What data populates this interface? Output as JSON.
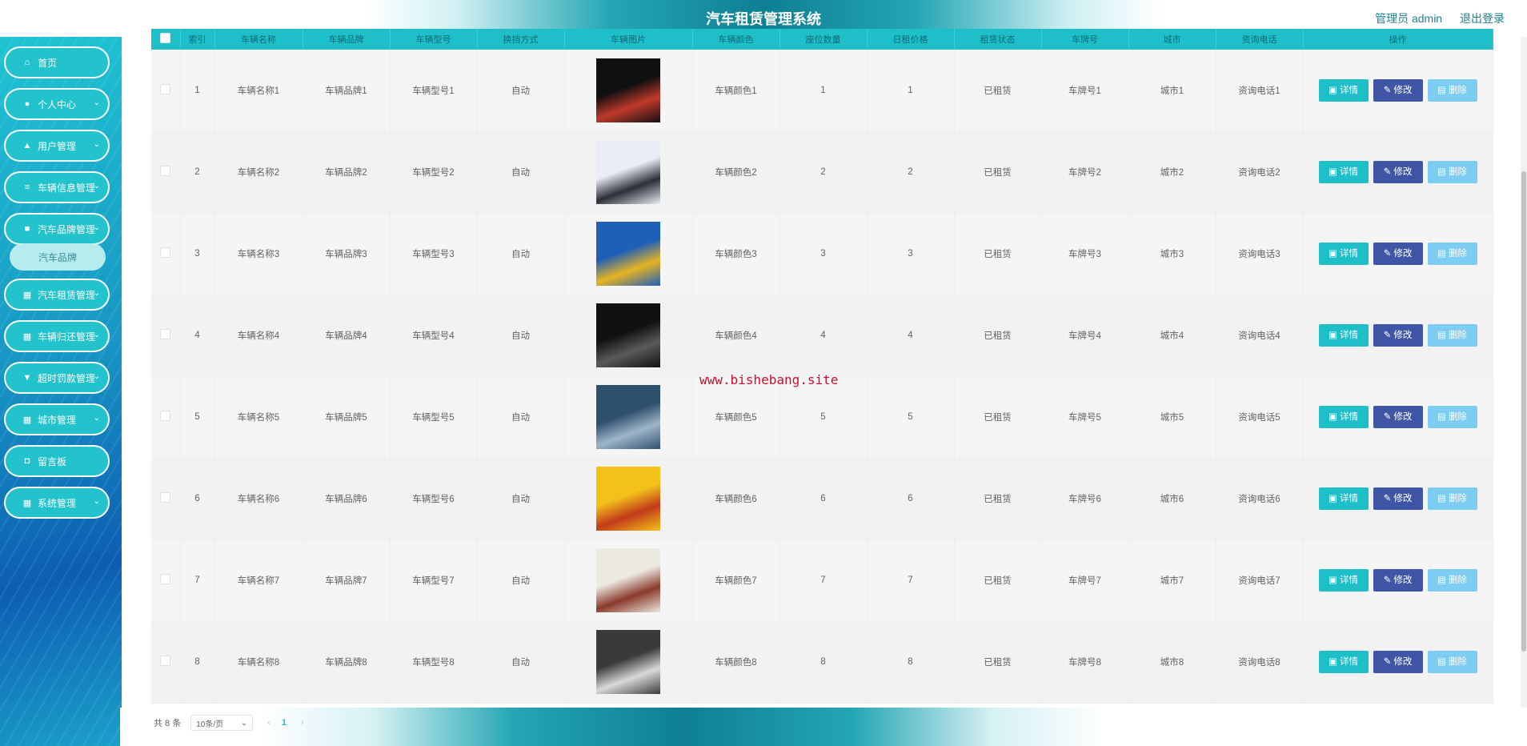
{
  "header": {
    "title": "汽车租赁管理系统",
    "user_label": "管理员 admin",
    "logout": "退出登录"
  },
  "sidebar": {
    "items": [
      {
        "label": "首页",
        "icon": "home-icon",
        "glyph": "⌂",
        "has_children": false
      },
      {
        "label": "个人中心",
        "icon": "user-icon",
        "glyph": "●",
        "has_children": true
      },
      {
        "label": "用户管理",
        "icon": "thumb-icon",
        "glyph": "▲",
        "has_children": true
      },
      {
        "label": "车辆信息管理",
        "icon": "menu-icon",
        "glyph": "≡",
        "has_children": true
      },
      {
        "label": "汽车品牌管理",
        "icon": "clipboard-icon",
        "glyph": "■",
        "has_children": true
      },
      {
        "label": "汽车租赁管理",
        "icon": "grid-icon",
        "glyph": "▦",
        "has_children": true
      },
      {
        "label": "车辆归还管理",
        "icon": "grid-icon",
        "glyph": "▦",
        "has_children": true
      },
      {
        "label": "超时罚款管理",
        "icon": "trophy-icon",
        "glyph": "▼",
        "has_children": true
      },
      {
        "label": "城市管理",
        "icon": "grid-icon",
        "glyph": "▦",
        "has_children": true
      },
      {
        "label": "留言板",
        "icon": "message-icon",
        "glyph": "◘",
        "has_children": false
      },
      {
        "label": "系统管理",
        "icon": "grid-icon",
        "glyph": "▦",
        "has_children": true
      }
    ],
    "open_submenu": {
      "label": "汽车品牌"
    }
  },
  "table": {
    "columns": [
      "",
      "索引",
      "车辆名称",
      "车辆品牌",
      "车辆型号",
      "换挡方式",
      "车辆图片",
      "车辆颜色",
      "座位数量",
      "日租价格",
      "租赁状态",
      "车牌号",
      "城市",
      "资询电话",
      "操作"
    ],
    "rows": [
      {
        "index": "1",
        "name": "车辆名称1",
        "brand": "车辆品牌1",
        "model": "车辆型号1",
        "shift": "自动",
        "color": "车辆颜色1",
        "seats": "1",
        "price": "1",
        "status": "已租赁",
        "plate": "车牌号1",
        "city": "城市1",
        "phone": "资询电话1",
        "img": [
          "#101010",
          "#c0392b"
        ]
      },
      {
        "index": "2",
        "name": "车辆名称2",
        "brand": "车辆品牌2",
        "model": "车辆型号2",
        "shift": "自动",
        "color": "车辆颜色2",
        "seats": "2",
        "price": "2",
        "status": "已租赁",
        "plate": "车牌号2",
        "city": "城市2",
        "phone": "资询电话2",
        "img": [
          "#e8eef3",
          "#2b2f36"
        ]
      },
      {
        "index": "3",
        "name": "车辆名称3",
        "brand": "车辆品牌3",
        "model": "车辆型号3",
        "shift": "自动",
        "color": "车辆颜色3",
        "seats": "3",
        "price": "3",
        "status": "已租赁",
        "plate": "车牌号3",
        "city": "城市3",
        "phone": "资询电话3",
        "img": [
          "#1e5fb8",
          "#e6b422"
        ]
      },
      {
        "index": "4",
        "name": "车辆名称4",
        "brand": "车辆品牌4",
        "model": "车辆型号4",
        "shift": "自动",
        "color": "车辆颜色4",
        "seats": "4",
        "price": "4",
        "status": "已租赁",
        "plate": "车牌号4",
        "city": "城市4",
        "phone": "资询电话4",
        "img": [
          "#111111",
          "#5a5a5a"
        ]
      },
      {
        "index": "5",
        "name": "车辆名称5",
        "brand": "车辆品牌5",
        "model": "车辆型号5",
        "shift": "自动",
        "color": "车辆颜色5",
        "seats": "5",
        "price": "5",
        "status": "已租赁",
        "plate": "车牌号5",
        "city": "城市5",
        "phone": "资询电话5",
        "img": [
          "#2f4f6f",
          "#9fb6c8"
        ]
      },
      {
        "index": "6",
        "name": "车辆名称6",
        "brand": "车辆品牌6",
        "model": "车辆型号6",
        "shift": "自动",
        "color": "车辆颜色6",
        "seats": "6",
        "price": "6",
        "status": "已租赁",
        "plate": "车牌号6",
        "city": "城市6",
        "phone": "资询电话6",
        "img": [
          "#f2c21b",
          "#c23a1a"
        ]
      },
      {
        "index": "7",
        "name": "车辆名称7",
        "brand": "车辆品牌7",
        "model": "车辆型号7",
        "shift": "自动",
        "color": "车辆颜色7",
        "seats": "7",
        "price": "7",
        "status": "已租赁",
        "plate": "车牌号7",
        "city": "城市7",
        "phone": "资询电话7",
        "img": [
          "#ece8e2",
          "#8a3a2a"
        ]
      },
      {
        "index": "8",
        "name": "车辆名称8",
        "brand": "车辆品牌8",
        "model": "车辆型号8",
        "shift": "自动",
        "color": "车辆颜色8",
        "seats": "8",
        "price": "8",
        "status": "已租赁",
        "plate": "车牌号8",
        "city": "城市8",
        "phone": "资询电话8",
        "img": [
          "#3a3a3a",
          "#d9d9d9"
        ]
      }
    ],
    "actions": {
      "detail": "详情",
      "edit": "修改",
      "delete": "删除"
    }
  },
  "watermark": "www.bishebang.site",
  "pagination": {
    "total": "共 8 条",
    "page_size": "10条/页",
    "current_page": "1"
  },
  "colors": {
    "accent": "#1fbfc9",
    "edit": "#3f55a6",
    "delete": "#7dcdf2"
  }
}
